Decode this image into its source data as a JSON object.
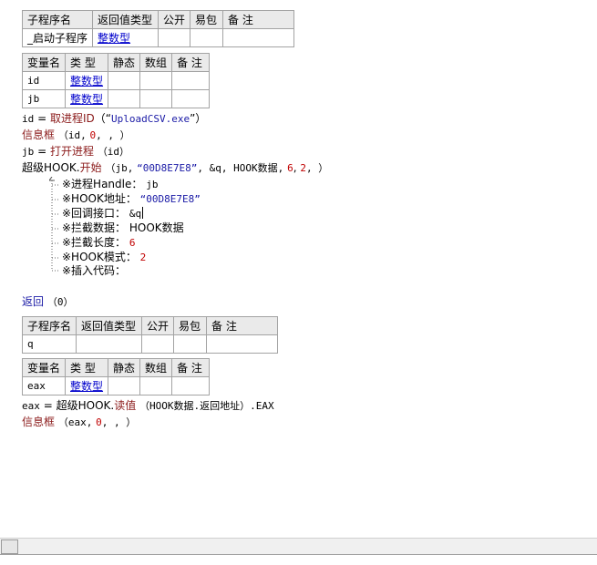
{
  "sub1": {
    "header": [
      "子程序名",
      "返回值类型",
      "公开",
      "易包",
      "备 注"
    ],
    "name": "_启动子程序",
    "return_type": "整数型",
    "var_header": [
      "变量名",
      "类 型",
      "静态",
      "数组",
      "备 注"
    ],
    "vars": [
      {
        "name": "id",
        "type": "整数型"
      },
      {
        "name": "jb",
        "type": "整数型"
      }
    ],
    "code": {
      "l1_var": "id",
      "l1_eq": "=",
      "l1_func": "取进程ID",
      "l1_args_open": "（“",
      "l1_str": "UploadCSV.exe",
      "l1_args_close": "”）",
      "l2_func": "信息框",
      "l2_args_a": "（id,",
      "l2_num": "0",
      "l2_args_b": ", , ）",
      "l3_var": "jb",
      "l3_eq": "=",
      "l3_func": "打开进程",
      "l3_args": "（id）",
      "l4_prefix": "超级HOOK.",
      "l4_func": "开始",
      "l4_args_a": "（jb,",
      "l4_str": "“00D8E7E8”",
      "l4_args_b": ", &q, HOOK数据,",
      "l4_num1": "6",
      "l4_sep": ",",
      "l4_num2": "2",
      "l4_args_c": ", ）"
    },
    "params": [
      {
        "label": "※进程Handle：",
        "value": "jb",
        "kind": "plain"
      },
      {
        "label": "※HOOK地址：",
        "value": "“00D8E7E8”",
        "kind": "str"
      },
      {
        "label": "※回调接口：",
        "value": "&q",
        "kind": "plain"
      },
      {
        "label": "※拦截数据：",
        "value": "HOOK数据",
        "kind": "plain"
      },
      {
        "label": "※拦截长度：",
        "value": "6",
        "kind": "num"
      },
      {
        "label": "※HOOK模式：",
        "value": "2",
        "kind": "num"
      },
      {
        "label": "※插入代码：",
        "value": "",
        "kind": "plain"
      }
    ],
    "return_kw": "返回",
    "return_args": "（0）"
  },
  "sub2": {
    "header": [
      "子程序名",
      "返回值类型",
      "公开",
      "易包",
      "备 注"
    ],
    "name": "q",
    "var_header": [
      "变量名",
      "类 型",
      "静态",
      "数组",
      "备 注"
    ],
    "vars": [
      {
        "name": "eax",
        "type": "整数型"
      }
    ],
    "code": {
      "l1_var": "eax",
      "l1_eq": "=",
      "l1_prefix": "超级HOOK.",
      "l1_func": "读值",
      "l1_args": "（HOOK数据.返回地址）.EAX",
      "l2_func": "信息框",
      "l2_args_a": "（eax,",
      "l2_num": "0",
      "l2_args_b": ", , ）"
    }
  }
}
